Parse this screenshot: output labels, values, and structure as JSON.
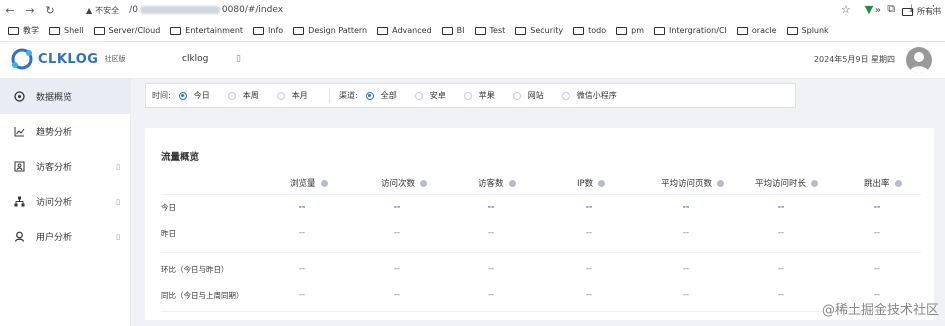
{
  "browser": {
    "insecure_label": "不安全",
    "url_prefix": "/0",
    "url_suffix": "0080/#/index",
    "bookmarks": [
      "教学",
      "Shell",
      "Server/Cloud",
      "Entertainment",
      "Info",
      "Design Pattern",
      "Advanced",
      "BI",
      "Test",
      "Security",
      "todo",
      "pm",
      "Intergration/CI",
      "oracle",
      "Splunk"
    ],
    "more_label": "»",
    "last_bookmark": "所有书"
  },
  "header": {
    "logo_text": "CLKLOG",
    "edition": "社区版",
    "app_name": "clklog",
    "date": "2024年5月9日 星期四"
  },
  "sidebar": {
    "items": [
      {
        "label": "数据概览",
        "icon": "gauge-icon"
      },
      {
        "label": "趋势分析",
        "icon": "trend-chart-icon"
      },
      {
        "label": "访客分析",
        "icon": "user-card-icon"
      },
      {
        "label": "访问分析",
        "icon": "sitemap-icon"
      },
      {
        "label": "用户分析",
        "icon": "user-icon"
      }
    ]
  },
  "filters": {
    "time_label": "时间:",
    "time_options": [
      "今日",
      "本周",
      "本月"
    ],
    "channel_label": "渠道:",
    "channel_options": [
      "全部",
      "安卓",
      "苹果",
      "网站",
      "微信小程序"
    ]
  },
  "overview": {
    "title": "流量概览",
    "columns": [
      "浏览量",
      "访问次数",
      "访客数",
      "IP数",
      "平均访问页数",
      "平均访问时长",
      "跳出率"
    ],
    "rows": [
      {
        "label": "今日",
        "values": [
          "--",
          "--",
          "--",
          "--",
          "--",
          "--",
          "--"
        ]
      },
      {
        "label": "昨日",
        "values": [
          "--",
          "--",
          "--",
          "--",
          "--",
          "--",
          "--"
        ]
      },
      {
        "label": "环比（今日与昨日）",
        "values": [
          "--",
          "--",
          "--",
          "--",
          "--",
          "--",
          "--"
        ]
      },
      {
        "label": "同比（今日与上周同期）",
        "values": [
          "--",
          "--",
          "--",
          "--",
          "--",
          "--",
          "--"
        ]
      }
    ]
  },
  "watermark": "@稀土掘金技术社区",
  "colors": {
    "accent": "#2f6fc6",
    "active_bg": "#e8ecf4"
  }
}
